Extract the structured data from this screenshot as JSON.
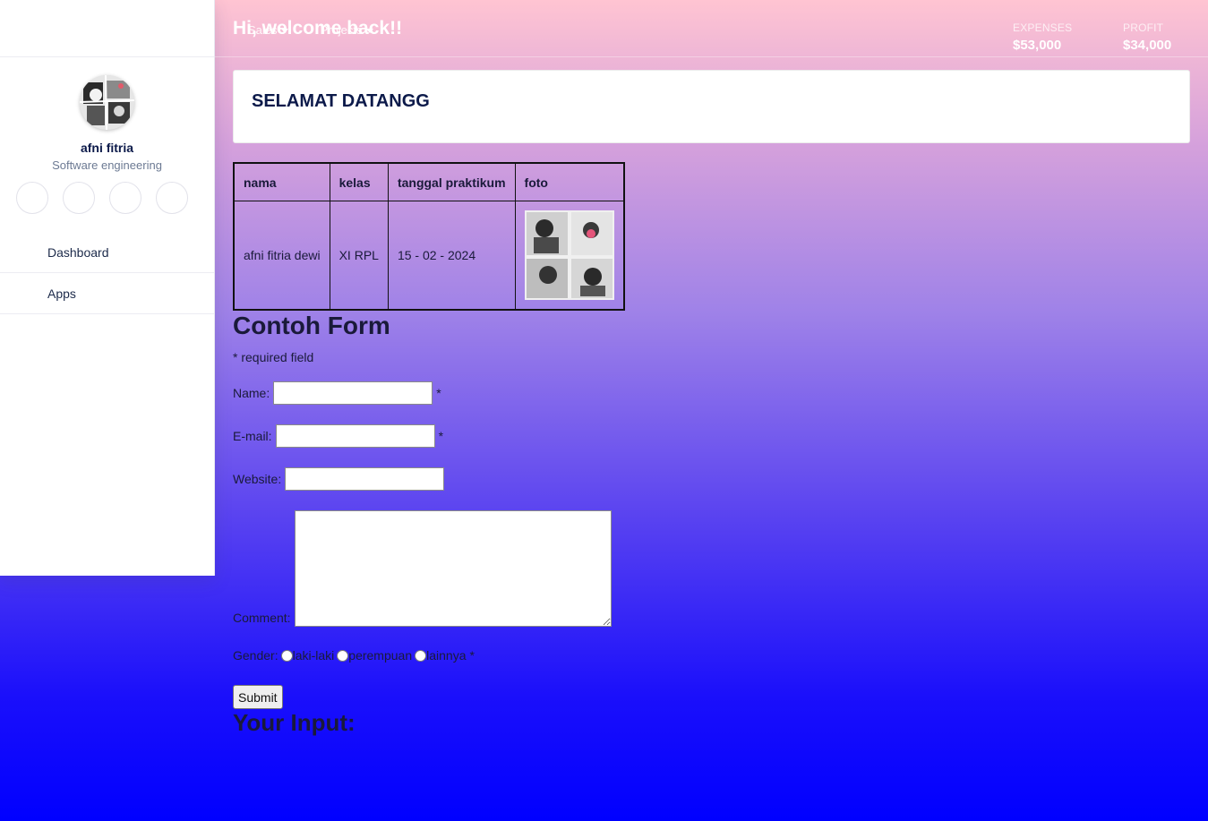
{
  "sidebar": {
    "user": {
      "name": "afni fitria",
      "role": "Software engineering"
    },
    "social_icons": [
      "facebook-icon",
      "twitter-icon",
      "instagram-icon",
      "linkedin-icon"
    ],
    "nav": [
      {
        "label": "Dashboard"
      },
      {
        "label": "Apps"
      }
    ]
  },
  "header": {
    "welcome": "Hi, welcome back!!",
    "menu": [
      "Sales",
      "Projects"
    ],
    "stats": [
      {
        "label": "EXPENSES",
        "value": "$53,000"
      },
      {
        "label": "PROFIT",
        "value": "$34,000"
      }
    ]
  },
  "card": {
    "title": "SELAMAT DATANGG"
  },
  "table": {
    "headers": [
      "nama",
      "kelas",
      "tanggal praktikum",
      "foto"
    ],
    "row": {
      "nama": "afni fitria dewi",
      "kelas": "XI RPL",
      "tanggal": "15 - 02 - 2024"
    }
  },
  "form": {
    "title": "Contoh Form",
    "required_note": "* required field",
    "name_label": "Name:",
    "email_label": "E-mail:",
    "website_label": "Website:",
    "comment_label": "Comment:",
    "gender_label": "Gender:",
    "gender_options": [
      "laki-laki",
      "perempuan",
      "lainnya"
    ],
    "asterisk": "*",
    "submit": "Submit"
  },
  "output": {
    "title": "Your Input:"
  },
  "colors": {
    "accent_dark": "#0c1a4a",
    "gradient_top": "#ffc4d2",
    "gradient_bottom": "#0000ff"
  }
}
